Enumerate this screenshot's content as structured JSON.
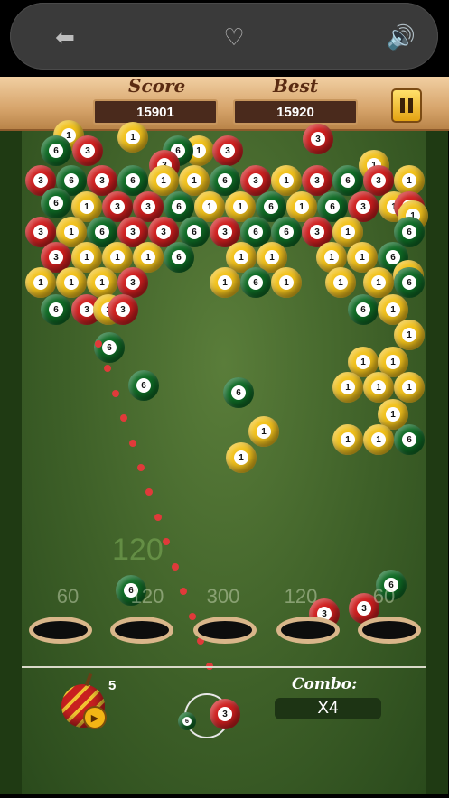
{
  "topbar": {
    "back_icon": "arrow-left-icon",
    "favorite_icon": "heart-icon",
    "sound_icon": "speaker-icon"
  },
  "header": {
    "score_label": "Score",
    "score_value": "15901",
    "best_label": "Best",
    "best_value": "15920"
  },
  "pockets": [
    {
      "value": "60"
    },
    {
      "value": "120"
    },
    {
      "value": "300"
    },
    {
      "value": "120"
    },
    {
      "value": "60"
    }
  ],
  "floating_score": "120",
  "bomb": {
    "count": "5"
  },
  "launcher": {
    "current_ball": "3",
    "next_ball": "6"
  },
  "combo": {
    "label": "Combo:",
    "value": "X4"
  },
  "balls": [
    "1",
    "1",
    "3",
    "6",
    "3",
    "1",
    "6",
    "3",
    "3",
    "1",
    "3",
    "6",
    "3",
    "6",
    "1",
    "1",
    "6",
    "3",
    "1",
    "3",
    "6",
    "3",
    "1",
    "6",
    "1",
    "3",
    "3",
    "6",
    "1",
    "1",
    "6",
    "1",
    "6",
    "3",
    "1",
    "3",
    "1",
    "3",
    "1",
    "6",
    "3",
    "3",
    "6",
    "3",
    "6",
    "6",
    "3",
    "1",
    "6",
    "3",
    "1",
    "1",
    "1",
    "6",
    "1",
    "1",
    "1",
    "1",
    "6",
    "1",
    "6",
    "1",
    "1",
    "1",
    "3",
    "1",
    "6",
    "1",
    "1",
    "1",
    "6",
    "6",
    "3",
    "1",
    "3",
    "1",
    "6",
    "6",
    "6",
    "1",
    "1",
    "6"
  ],
  "colors": {
    "accent": "#f2c21c",
    "red": "#cf1f1f",
    "green": "#0f6b25",
    "felt": "#3e6028",
    "wood": "#d7a56c"
  }
}
